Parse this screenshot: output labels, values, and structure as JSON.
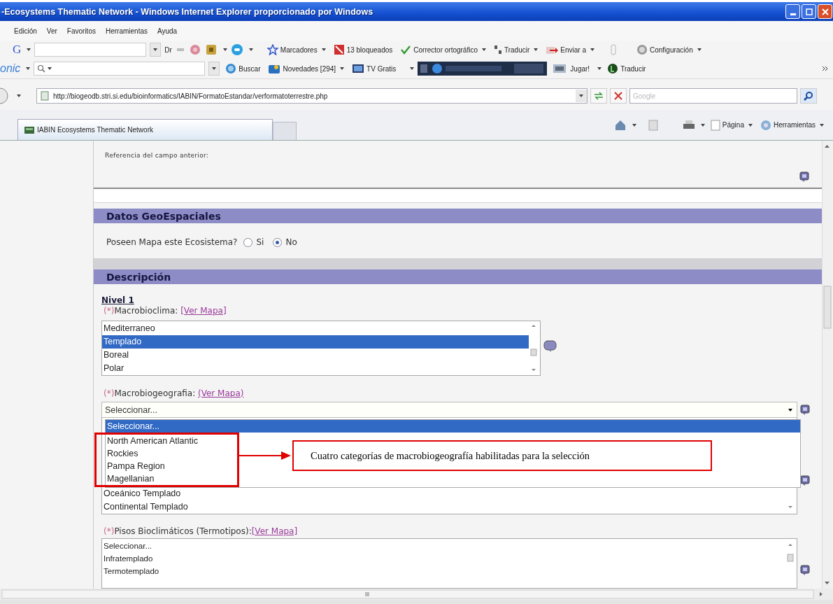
{
  "window": {
    "title": "-Ecosystems Thematic Network - Windows Internet Explorer proporcionado por Windows"
  },
  "menu": [
    {
      "label": "Edición"
    },
    {
      "label": "Ver"
    },
    {
      "label": "Favoritos"
    },
    {
      "label": "Herramientas"
    },
    {
      "label": "Ayuda"
    }
  ],
  "toolbar_1": {
    "logo": "G",
    "search_text": "Dr",
    "bookmarks": "Marcadores",
    "blocked": "13 bloqueados",
    "spellcheck": "Corrector ortográfico",
    "translate": "Traducir",
    "send": "Enviar a",
    "settings": "Configuración"
  },
  "toolbar_2": {
    "name": "onic",
    "search": "Buscar",
    "news": "Novedades [294]",
    "tv": "TV Gratis",
    "games": "Jugar!",
    "translate": "Traducir"
  },
  "address_bar": {
    "url": "http://biogeodb.stri.si.edu/bioinformatics/IABIN/FormatoEstandar/verformatoterrestre.php",
    "search_placeholder": "Google"
  },
  "tabs": [
    {
      "label": "IABIN Ecosystems Thematic Network",
      "selected": true
    }
  ],
  "command_bar": {
    "page": "Página",
    "tools": "Herramientas"
  },
  "reference_label": "Referencia del campo anterior:",
  "geo_section": {
    "title": "Datos GeoEspaciales",
    "question": "Poseen Mapa este Ecosistema?",
    "options": [
      {
        "label": "Si",
        "selected": false
      },
      {
        "label": "No",
        "selected": true
      }
    ]
  },
  "description_section": {
    "title": "Descripción",
    "level": "Nivel 1",
    "macrobioclima": {
      "required": "(*)",
      "label": "Macrobioclima:",
      "link": "[Ver Mapa]",
      "options": [
        {
          "label": "Mediterraneo",
          "selected": false
        },
        {
          "label": "Templado",
          "selected": true
        },
        {
          "label": "Boreal",
          "selected": false
        },
        {
          "label": "Polar",
          "selected": false
        }
      ]
    },
    "macrobiogeografia": {
      "required": "(*)",
      "label": "Macrobiogeografia:",
      "link": "(Ver Mapa)",
      "value": "Seleccionar...",
      "dropdown_options": [
        {
          "label": "Seleccionar...",
          "selected": true
        },
        {
          "label": "North American Atlantic",
          "selected": false
        },
        {
          "label": "Rockies",
          "selected": false
        },
        {
          "label": "Pampa Region",
          "selected": false
        },
        {
          "label": "Magellanian",
          "selected": false
        }
      ]
    },
    "next_list": {
      "options": [
        {
          "label": "Oceánico Templado",
          "selected": false
        },
        {
          "label": "Continental Templado",
          "selected": false
        }
      ]
    },
    "pisos": {
      "required": "(*)",
      "label": "Pisos Bioclimáticos (Termotipos):",
      "link": "[Ver Mapa]",
      "options": [
        {
          "label": "Seleccionar...",
          "selected": false
        },
        {
          "label": "Infratemplado",
          "selected": false
        },
        {
          "label": "Termotemplado",
          "selected": false
        }
      ]
    }
  },
  "annotation": {
    "text": "Cuatro categorías de macrobiogeografía habilitadas para la selección"
  }
}
